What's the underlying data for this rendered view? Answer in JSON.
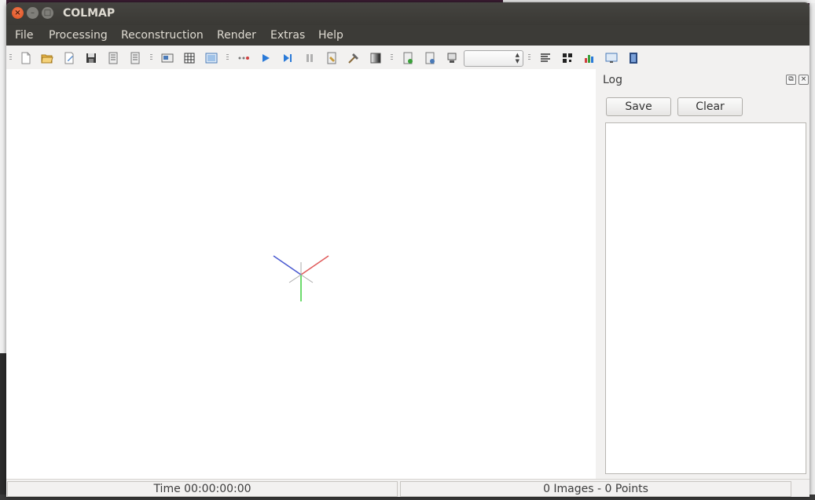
{
  "window": {
    "title": "COLMAP",
    "controls": {
      "close_glyph": "×",
      "minimize_glyph": "–",
      "maximize_glyph": "□"
    }
  },
  "menubar": {
    "items": [
      "File",
      "Processing",
      "Reconstruction",
      "Render",
      "Extras",
      "Help"
    ]
  },
  "toolbar": {
    "groups": [
      [
        "new-project-icon",
        "open-project-icon",
        "edit-project-icon",
        "save-project-icon",
        "import-model-icon",
        "export-model-icon"
      ],
      [
        "feature-extraction-icon",
        "feature-matching-icon",
        "database-management-icon"
      ],
      [
        "automatic-reconstruction-icon",
        "start-reconstruction-icon",
        "step-reconstruction-icon",
        "pause-reconstruction-icon",
        "reconstruction-options-icon",
        "bundle-adjustment-icon",
        "dense-reconstruction-icon"
      ],
      [
        "render-options-icon",
        "reset-view-icon",
        "grab-image-icon"
      ],
      [
        "log-icon",
        "match-matrix-icon",
        "reconstruction-stats-icon",
        "grab-movie-icon",
        "film-icon"
      ]
    ],
    "reconstruction_select": {
      "value": ""
    }
  },
  "log_panel": {
    "title": "Log",
    "save_label": "Save",
    "clear_label": "Clear",
    "float_glyph": "⧉",
    "close_glyph": "×",
    "content": ""
  },
  "status": {
    "time": "Time 00:00:00:00",
    "counts": "0 Images - 0 Points"
  },
  "colors": {
    "axis_x": "#e05a5a",
    "axis_y": "#4a5ad0",
    "axis_z": "#3ccf3c",
    "menu_bg": "#3c3b37",
    "close_button": "#dd4f1c"
  }
}
